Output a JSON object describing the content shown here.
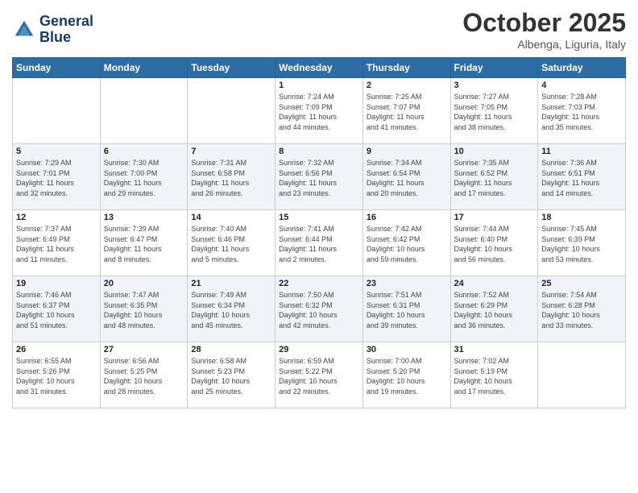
{
  "header": {
    "logo_line1": "General",
    "logo_line2": "Blue",
    "month": "October 2025",
    "location": "Albenga, Liguria, Italy"
  },
  "weekdays": [
    "Sunday",
    "Monday",
    "Tuesday",
    "Wednesday",
    "Thursday",
    "Friday",
    "Saturday"
  ],
  "weeks": [
    [
      {
        "day": "",
        "info": ""
      },
      {
        "day": "",
        "info": ""
      },
      {
        "day": "",
        "info": ""
      },
      {
        "day": "1",
        "info": "Sunrise: 7:24 AM\nSunset: 7:09 PM\nDaylight: 11 hours\nand 44 minutes."
      },
      {
        "day": "2",
        "info": "Sunrise: 7:25 AM\nSunset: 7:07 PM\nDaylight: 11 hours\nand 41 minutes."
      },
      {
        "day": "3",
        "info": "Sunrise: 7:27 AM\nSunset: 7:05 PM\nDaylight: 11 hours\nand 38 minutes."
      },
      {
        "day": "4",
        "info": "Sunrise: 7:28 AM\nSunset: 7:03 PM\nDaylight: 11 hours\nand 35 minutes."
      }
    ],
    [
      {
        "day": "5",
        "info": "Sunrise: 7:29 AM\nSunset: 7:01 PM\nDaylight: 11 hours\nand 32 minutes."
      },
      {
        "day": "6",
        "info": "Sunrise: 7:30 AM\nSunset: 7:00 PM\nDaylight: 11 hours\nand 29 minutes."
      },
      {
        "day": "7",
        "info": "Sunrise: 7:31 AM\nSunset: 6:58 PM\nDaylight: 11 hours\nand 26 minutes."
      },
      {
        "day": "8",
        "info": "Sunrise: 7:32 AM\nSunset: 6:56 PM\nDaylight: 11 hours\nand 23 minutes."
      },
      {
        "day": "9",
        "info": "Sunrise: 7:34 AM\nSunset: 6:54 PM\nDaylight: 11 hours\nand 20 minutes."
      },
      {
        "day": "10",
        "info": "Sunrise: 7:35 AM\nSunset: 6:52 PM\nDaylight: 11 hours\nand 17 minutes."
      },
      {
        "day": "11",
        "info": "Sunrise: 7:36 AM\nSunset: 6:51 PM\nDaylight: 11 hours\nand 14 minutes."
      }
    ],
    [
      {
        "day": "12",
        "info": "Sunrise: 7:37 AM\nSunset: 6:49 PM\nDaylight: 11 hours\nand 11 minutes."
      },
      {
        "day": "13",
        "info": "Sunrise: 7:39 AM\nSunset: 6:47 PM\nDaylight: 11 hours\nand 8 minutes."
      },
      {
        "day": "14",
        "info": "Sunrise: 7:40 AM\nSunset: 6:46 PM\nDaylight: 11 hours\nand 5 minutes."
      },
      {
        "day": "15",
        "info": "Sunrise: 7:41 AM\nSunset: 6:44 PM\nDaylight: 11 hours\nand 2 minutes."
      },
      {
        "day": "16",
        "info": "Sunrise: 7:42 AM\nSunset: 6:42 PM\nDaylight: 10 hours\nand 59 minutes."
      },
      {
        "day": "17",
        "info": "Sunrise: 7:44 AM\nSunset: 6:40 PM\nDaylight: 10 hours\nand 56 minutes."
      },
      {
        "day": "18",
        "info": "Sunrise: 7:45 AM\nSunset: 6:39 PM\nDaylight: 10 hours\nand 53 minutes."
      }
    ],
    [
      {
        "day": "19",
        "info": "Sunrise: 7:46 AM\nSunset: 6:37 PM\nDaylight: 10 hours\nand 51 minutes."
      },
      {
        "day": "20",
        "info": "Sunrise: 7:47 AM\nSunset: 6:35 PM\nDaylight: 10 hours\nand 48 minutes."
      },
      {
        "day": "21",
        "info": "Sunrise: 7:49 AM\nSunset: 6:34 PM\nDaylight: 10 hours\nand 45 minutes."
      },
      {
        "day": "22",
        "info": "Sunrise: 7:50 AM\nSunset: 6:32 PM\nDaylight: 10 hours\nand 42 minutes."
      },
      {
        "day": "23",
        "info": "Sunrise: 7:51 AM\nSunset: 6:31 PM\nDaylight: 10 hours\nand 39 minutes."
      },
      {
        "day": "24",
        "info": "Sunrise: 7:52 AM\nSunset: 6:29 PM\nDaylight: 10 hours\nand 36 minutes."
      },
      {
        "day": "25",
        "info": "Sunrise: 7:54 AM\nSunset: 6:28 PM\nDaylight: 10 hours\nand 33 minutes."
      }
    ],
    [
      {
        "day": "26",
        "info": "Sunrise: 6:55 AM\nSunset: 5:26 PM\nDaylight: 10 hours\nand 31 minutes."
      },
      {
        "day": "27",
        "info": "Sunrise: 6:56 AM\nSunset: 5:25 PM\nDaylight: 10 hours\nand 28 minutes."
      },
      {
        "day": "28",
        "info": "Sunrise: 6:58 AM\nSunset: 5:23 PM\nDaylight: 10 hours\nand 25 minutes."
      },
      {
        "day": "29",
        "info": "Sunrise: 6:59 AM\nSunset: 5:22 PM\nDaylight: 10 hours\nand 22 minutes."
      },
      {
        "day": "30",
        "info": "Sunrise: 7:00 AM\nSunset: 5:20 PM\nDaylight: 10 hours\nand 19 minutes."
      },
      {
        "day": "31",
        "info": "Sunrise: 7:02 AM\nSunset: 5:19 PM\nDaylight: 10 hours\nand 17 minutes."
      },
      {
        "day": "",
        "info": ""
      }
    ]
  ]
}
